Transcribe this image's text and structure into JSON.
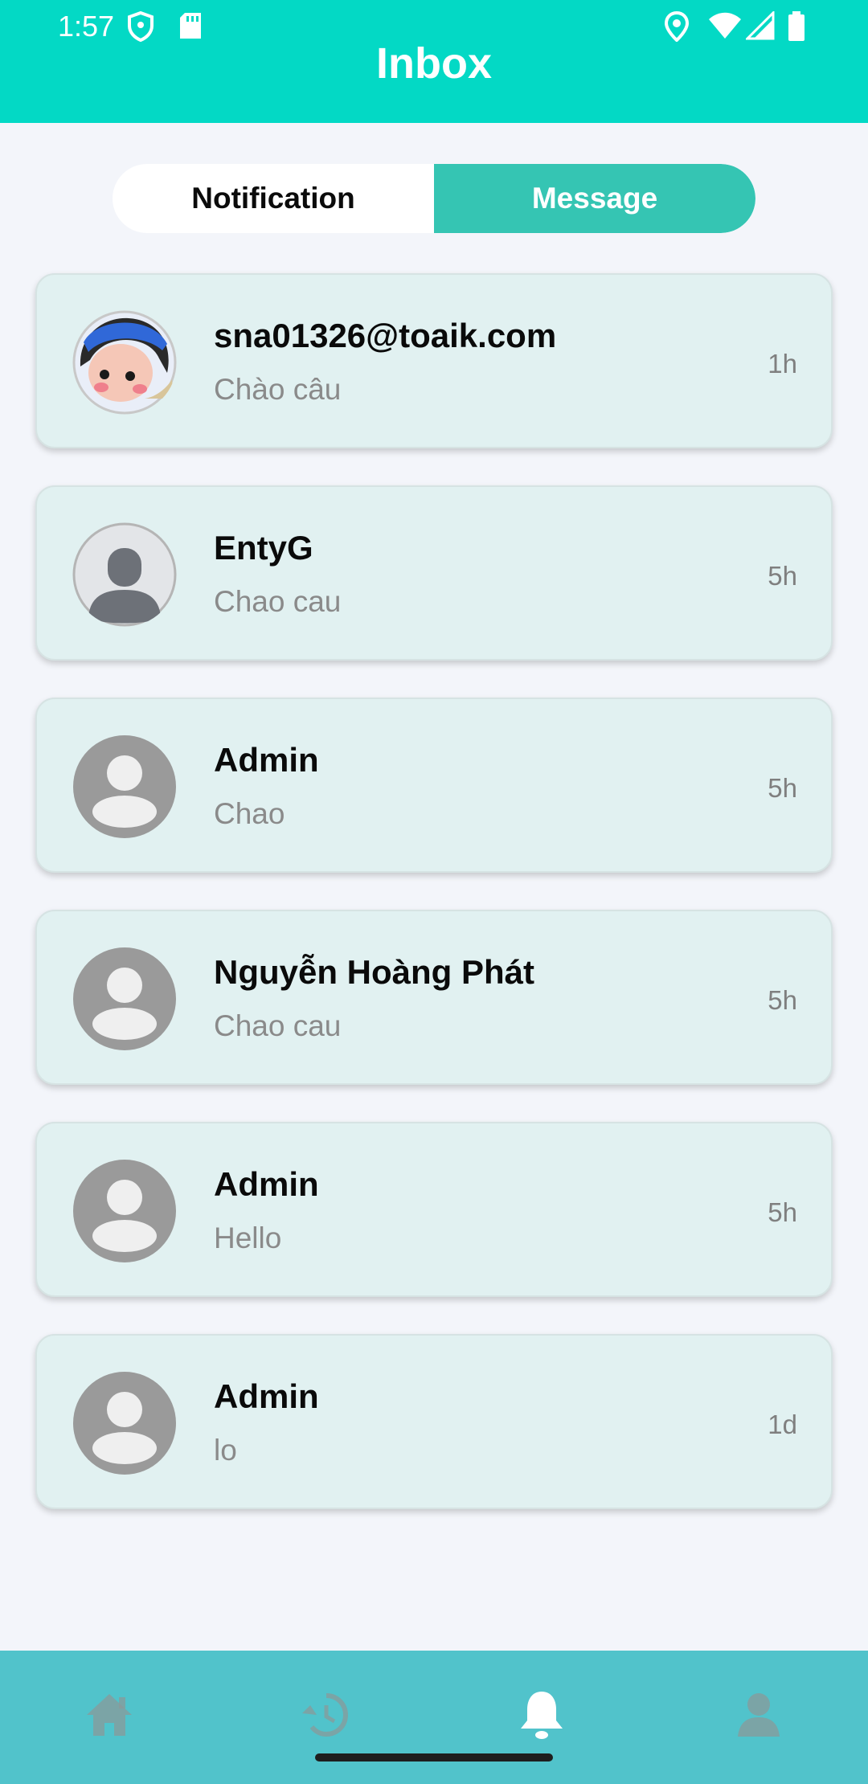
{
  "status_bar": {
    "time": "1:57",
    "icons": [
      "shield-icon",
      "sd-card-icon",
      "location-icon",
      "wifi-icon",
      "signal-icon",
      "battery-icon"
    ]
  },
  "header": {
    "title": "Inbox"
  },
  "tabs": [
    {
      "label": "Notification",
      "active": false
    },
    {
      "label": "Message",
      "active": true
    }
  ],
  "messages": [
    {
      "name": "sna01326@toaik.com",
      "preview": "Chào câu",
      "time": "1h",
      "avatar": "cartoon-avatar"
    },
    {
      "name": "EntyG",
      "preview": "Chao cau",
      "time": "5h",
      "avatar": "default-user-avatar"
    },
    {
      "name": "Admin",
      "preview": "Chao",
      "time": "5h",
      "avatar": "placeholder-avatar"
    },
    {
      "name": "Nguyễn Hoàng Phát",
      "preview": "Chao cau",
      "time": "5h",
      "avatar": "placeholder-avatar"
    },
    {
      "name": "Admin",
      "preview": "Hello",
      "time": "5h",
      "avatar": "placeholder-avatar"
    },
    {
      "name": "Admin",
      "preview": "lo",
      "time": "1d",
      "avatar": "placeholder-avatar"
    }
  ],
  "bottom_nav": {
    "items": [
      "home-icon",
      "history-icon",
      "bell-icon",
      "profile-icon"
    ],
    "active": "bell-icon"
  },
  "colors": {
    "header": "#03d9c5",
    "active_tab": "#35c5b3",
    "card_bg": "#e1f1f1",
    "bottom_nav": "#51c3cb"
  }
}
